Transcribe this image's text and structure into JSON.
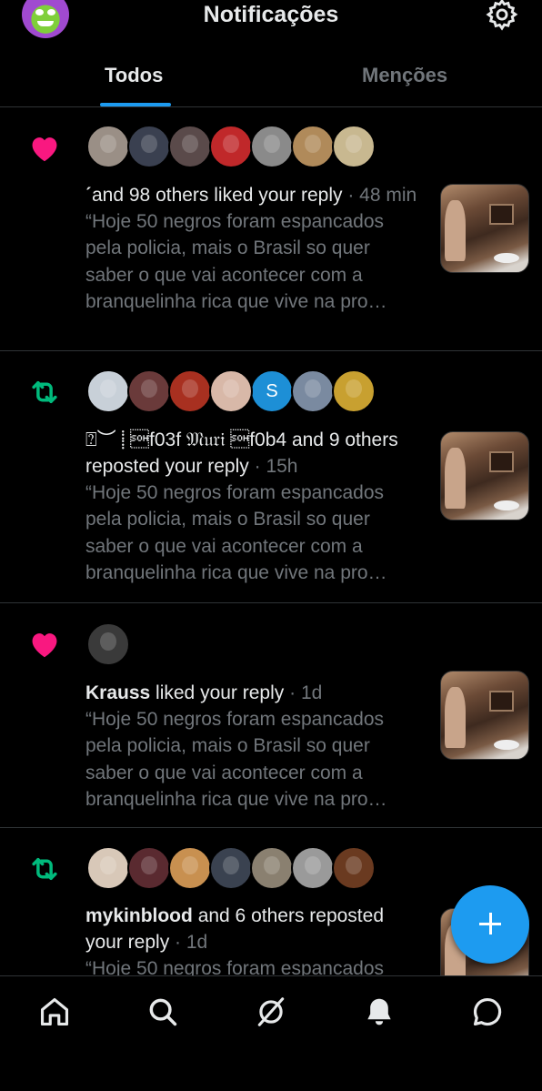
{
  "header": {
    "title": "Notificações"
  },
  "tabs": [
    {
      "label": "Todos",
      "selected": true
    },
    {
      "label": "Menções",
      "selected": false
    }
  ],
  "colors": {
    "accent": "#1d9bf0",
    "like": "#f91880",
    "repost": "#00ba7c",
    "muted": "#71767b"
  },
  "notifications": [
    {
      "type": "like",
      "icon": "heart-icon",
      "who": "",
      "prefix": "ˊ",
      "action": "and 98 others liked your reply",
      "time": "48 min",
      "snippet": "“Hoje 50 negros foram espancados pela policia, mais o Brasil so quer saber o que vai acontecer com a branquelinha rica que vive na pro…"
    },
    {
      "type": "repost",
      "icon": "repost-icon",
      "who": "⍰︶ ⸽ \u0001f03f 𝔐𝔲𝔯𝔦 \u0001f0b4",
      "action": "and 9 others reposted your reply",
      "time": "15h",
      "snippet": "“Hoje 50 negros foram espancados pela policia, mais o Brasil so quer saber o que vai acontecer com a branquelinha rica que vive na pro…",
      "avatar_letter": "S"
    },
    {
      "type": "like",
      "icon": "heart-icon",
      "who": "Krauss",
      "action": "liked your reply",
      "time": "1d",
      "snippet": "“Hoje 50 negros foram espancados pela policia, mais o Brasil so quer saber o que vai acontecer com a branquelinha rica que vive na pro…"
    },
    {
      "type": "repost",
      "icon": "repost-icon",
      "who": "mykinblood",
      "action": "and 6 others reposted your reply",
      "time": "1d",
      "snippet": "“Hoje 50 negros foram espancados"
    }
  ],
  "fab": {
    "icon": "plus-icon"
  },
  "bottom_nav": [
    "home-icon",
    "search-icon",
    "grok-icon",
    "bell-icon",
    "messages-icon"
  ]
}
